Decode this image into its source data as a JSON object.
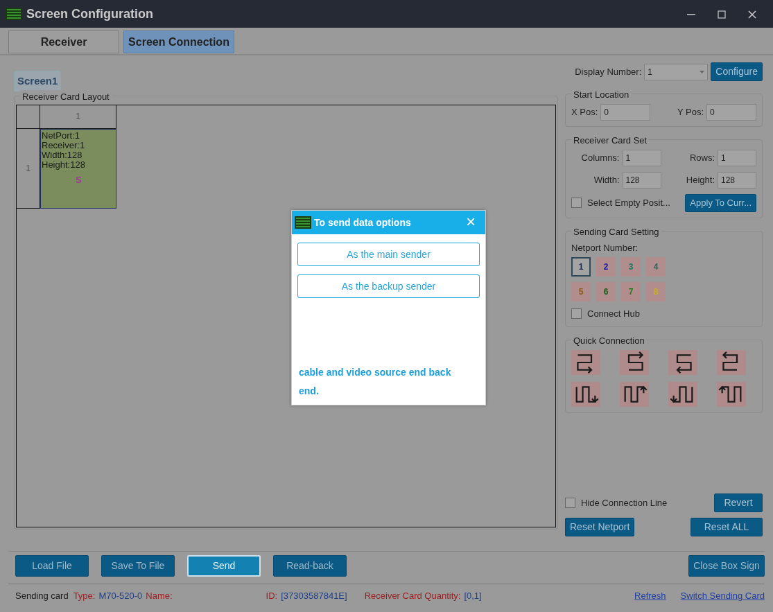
{
  "window": {
    "title": "Screen Configuration"
  },
  "tabs": [
    {
      "label": "Receiver",
      "selected": false
    },
    {
      "label": "Screen Connection",
      "selected": true
    }
  ],
  "screen_tabs": [
    {
      "label": "Screen1",
      "selected": true
    }
  ],
  "layout": {
    "title": "Receiver Card Layout",
    "column_headers": [
      "1"
    ],
    "rows": [
      {
        "header": "1",
        "cards": [
          {
            "lines": [
              "NetPort:1",
              "Receiver:1",
              "Width:128",
              "Height:128"
            ],
            "marker": "S"
          }
        ]
      }
    ]
  },
  "display_number": {
    "label": "Display Number:",
    "value": "1",
    "button": "Configure"
  },
  "start_location": {
    "title": "Start Location",
    "fields": [
      {
        "label": "X Pos:",
        "value": "0"
      },
      {
        "label": "Y Pos:",
        "value": "0"
      }
    ]
  },
  "receiver_card_set": {
    "title": "Receiver Card Set",
    "fields": [
      {
        "label": "Columns:",
        "value": "1"
      },
      {
        "label": "Rows:",
        "value": "1"
      },
      {
        "label": "Width:",
        "value": "128"
      },
      {
        "label": "Height:",
        "value": "128"
      }
    ],
    "checkbox": {
      "label": "Select Empty Posit...",
      "checked": false
    },
    "button": "Apply To Curr..."
  },
  "sending_card_setting": {
    "title": "Sending Card Setting",
    "subtitle": "Netport Number:",
    "ports": [
      {
        "label": "1",
        "color": "#1b2a4a",
        "selected": true
      },
      {
        "label": "2",
        "color": "#1a1aa0",
        "selected": false
      },
      {
        "label": "3",
        "color": "#137a60",
        "selected": false
      },
      {
        "label": "4",
        "color": "#2a6a5a",
        "selected": false
      },
      {
        "label": "5",
        "color": "#8a5a1a",
        "selected": false
      },
      {
        "label": "6",
        "color": "#1a5a1a",
        "selected": false
      },
      {
        "label": "7",
        "color": "#1a7a1a",
        "selected": false
      },
      {
        "label": "8",
        "color": "#c8b020",
        "selected": false
      }
    ],
    "checkbox": {
      "label": "Connect Hub",
      "checked": false
    }
  },
  "quick_connection": {
    "title": "Quick Connection"
  },
  "hide_connection_line": {
    "label": "Hide Connection Line",
    "checked": false
  },
  "side_buttons": [
    "Revert",
    "Reset Netport",
    "Reset ALL"
  ],
  "bottom_buttons": [
    {
      "label": "Load File",
      "selected": false
    },
    {
      "label": "Save To File",
      "selected": false
    },
    {
      "label": "Send",
      "selected": true
    },
    {
      "label": "Read-back",
      "selected": false
    }
  ],
  "close_box_sign": "Close Box Sign",
  "status_bar": {
    "items": [
      {
        "text": "Sending card",
        "kind": "plain"
      },
      {
        "text": "Type:",
        "kind": "label"
      },
      {
        "text": "M70-520-0",
        "kind": "value"
      },
      {
        "text": "Name:",
        "kind": "label"
      },
      {
        "text": "ID:",
        "kind": "label"
      },
      {
        "text": "[37303587841E]",
        "kind": "value"
      },
      {
        "text": "Receiver Card Quantity:",
        "kind": "label"
      },
      {
        "text": "[0,1]",
        "kind": "value"
      }
    ],
    "links": [
      "Refresh",
      "Switch Sending Card"
    ]
  },
  "dialog": {
    "title": "To send data options",
    "close": "×",
    "options": [
      "As the main sender",
      "As the backup sender"
    ],
    "message": "cable and video source end back end."
  }
}
